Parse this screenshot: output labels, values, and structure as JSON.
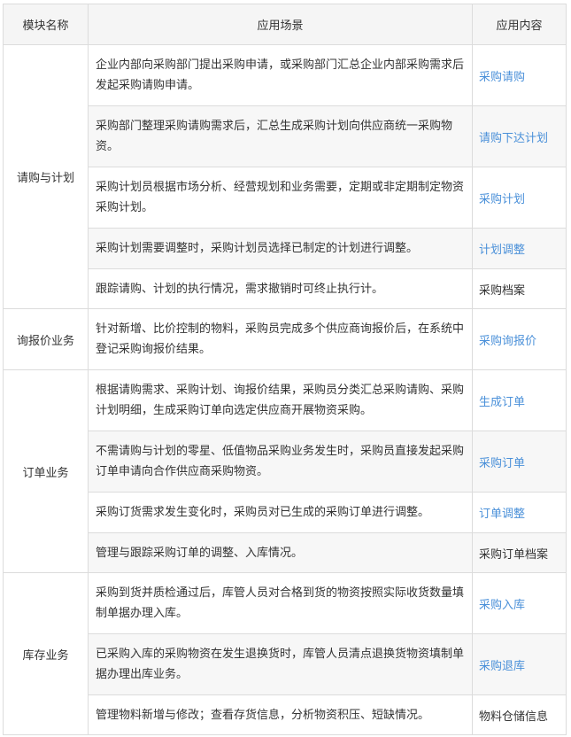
{
  "headers": [
    "模块名称",
    "应用场景",
    "应用内容"
  ],
  "groups": [
    {
      "module": "请购与计划",
      "rows": [
        {
          "scene": "企业内部向采购部门提出采购申请，或采购部门汇总企业内部采购需求后发起采购请购申请。",
          "content": "采购请购",
          "link": true
        },
        {
          "scene": "采购部门整理采购请购需求后，汇总生成采购计划向供应商统一采购物资。",
          "content": "请购下达计划",
          "link": true
        },
        {
          "scene": "采购计划员根据市场分析、经营规划和业务需要，定期或非定期制定物资采购计划。",
          "content": "采购计划",
          "link": true
        },
        {
          "scene": "采购计划需要调整时，采购计划员选择已制定的计划进行调整。",
          "content": "计划调整",
          "link": true
        },
        {
          "scene": "跟踪请购、计划的执行情况，需求撤销时可终止执行计。",
          "content": "采购档案",
          "link": false
        }
      ]
    },
    {
      "module": "询报价业务",
      "rows": [
        {
          "scene": "针对新增、比价控制的物料，采购员完成多个供应商询报价后，在系统中登记采购询报价结果。",
          "content": "采购询报价",
          "link": true
        }
      ]
    },
    {
      "module": "订单业务",
      "rows": [
        {
          "scene": "根据请购需求、采购计划、询报价结果，采购员分类汇总采购请购、采购计划明细，生成采购订单向选定供应商开展物资采购。",
          "content": "生成订单",
          "link": true
        },
        {
          "scene": "不需请购与计划的零星、低值物品采购业务发生时，采购员直接发起采购订单申请向合作供应商采购物资。",
          "content": "采购订单",
          "link": true
        },
        {
          "scene": "采购订货需求发生变化时，采购员对已生成的采购订单进行调整。",
          "content": "订单调整",
          "link": true
        },
        {
          "scene": "管理与跟踪采购订单的调整、入库情况。",
          "content": "采购订单档案",
          "link": false
        }
      ]
    },
    {
      "module": "库存业务",
      "rows": [
        {
          "scene": "采购到货并质检通过后，库管人员对合格到货的物资按照实际收货数量填制单据办理入库。",
          "content": "采购入库",
          "link": true
        },
        {
          "scene": "已采购入库的采购物资在发生退换货时，库管人员清点退换货物资填制单据办理出库业务。",
          "content": "采购退库",
          "link": true
        },
        {
          "scene": "管理物料新增与修改；查看存货信息，分析物资积压、短缺情况。",
          "content": "物料仓储信息",
          "link": false
        }
      ]
    }
  ],
  "colors": {
    "link": "#4a90d9",
    "text": "#333333",
    "border": "#dcdcdc",
    "header_bg": "#f5f5f5",
    "alt_bg": "#f7f7f7"
  }
}
